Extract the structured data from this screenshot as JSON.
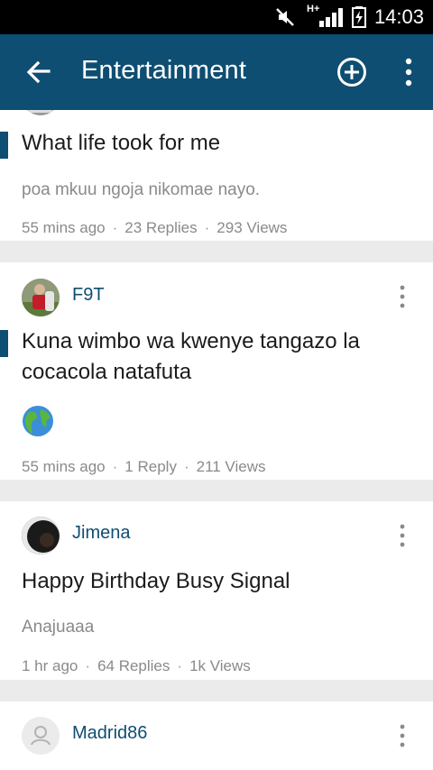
{
  "status_bar": {
    "time": "14:03",
    "network": "H+"
  },
  "app_bar": {
    "title": "Entertainment",
    "back_icon": "arrow-back-icon",
    "add_icon": "add-circle-icon",
    "more_icon": "more-vert-icon"
  },
  "colors": {
    "primary": "#0e4e72",
    "meta_text": "#8a8a8a",
    "separator": "#ebebeb"
  },
  "posts": [
    {
      "title": "What life took for me",
      "snippet": "poa mkuu ngoja nikomae nayo.",
      "time": "55 mins ago",
      "replies": "23 Replies",
      "views": "293 Views"
    },
    {
      "author": "F9T",
      "title": "Kuna wimbo wa kwenye tangazo la cocacola natafuta",
      "attachment_icon": "globe-emoji-icon",
      "time": "55 mins ago",
      "replies": "1 Reply",
      "views": "211 Views"
    },
    {
      "author": "Jimena",
      "title": "Happy Birthday Busy Signal",
      "snippet": "Anajuaaa",
      "time": "1 hr ago",
      "replies": "64 Replies",
      "views": "1k Views"
    },
    {
      "author": "Madrid86"
    }
  ],
  "separator_dot": "·"
}
